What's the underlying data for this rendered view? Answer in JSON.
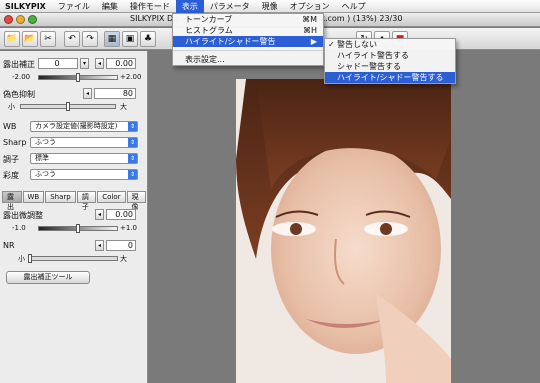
{
  "menubar": {
    "app": "SILKYPIX",
    "items": [
      "ファイル",
      "編集",
      "操作モード",
      "表示",
      "パラメータ",
      "現像",
      "オプション",
      "ヘルプ"
    ],
    "active_index": 3
  },
  "window": {
    "title_left": "SILKYPIX De",
    "title_right": "ix.com ) (13%)  23/30"
  },
  "view_menu": {
    "items": [
      {
        "label": "トーンカーブ",
        "shortcut": "⌘M"
      },
      {
        "label": "ヒストグラム",
        "shortcut": "⌘H"
      },
      {
        "label": "ハイライト/シャドー警告",
        "shortcut": "▶"
      },
      {
        "label": "表示設定...",
        "shortcut": ""
      }
    ]
  },
  "warning_submenu": {
    "items": [
      {
        "label": "警告しない",
        "checked": true
      },
      {
        "label": "ハイライト警告する",
        "checked": false
      },
      {
        "label": "シャドー警告する",
        "checked": false
      },
      {
        "label": "ハイライト/シャドー警告する",
        "checked": false
      }
    ]
  },
  "panel": {
    "exposure_label": "露出補正",
    "exposure_preset": "0",
    "exposure_value": "0.00",
    "exposure_min": "-2.00",
    "exposure_max": "+2.00",
    "exposure_level": 0.5,
    "fringe_label": "偽色抑制",
    "fringe_value": "80",
    "fringe_small": "小",
    "fringe_large": "大",
    "fringe_level": 0.5,
    "wb_label": "WB",
    "wb_value": "カメラ設定値(撮影時設定)",
    "sharp_label": "Sharp",
    "sharp_value": "ふつう",
    "tone_label": "調子",
    "tone_value": "標準",
    "saturation_label": "彩度",
    "saturation_value": "ふつう",
    "tabs": [
      "露出",
      "WB",
      "Sharp",
      "調子",
      "Color",
      "現像"
    ],
    "fine_label": "露出微調整",
    "fine_value": "0.00",
    "fine_min": "-1.0",
    "fine_max": "+1.0",
    "fine_level": 0.5,
    "nr_label": "NR",
    "nr_value": "0",
    "nr_small": "小",
    "nr_large": "大",
    "nr_level": 0.0,
    "tool_button": "露出補正ツール"
  },
  "icons": {
    "accent": "#2c5fd6"
  }
}
